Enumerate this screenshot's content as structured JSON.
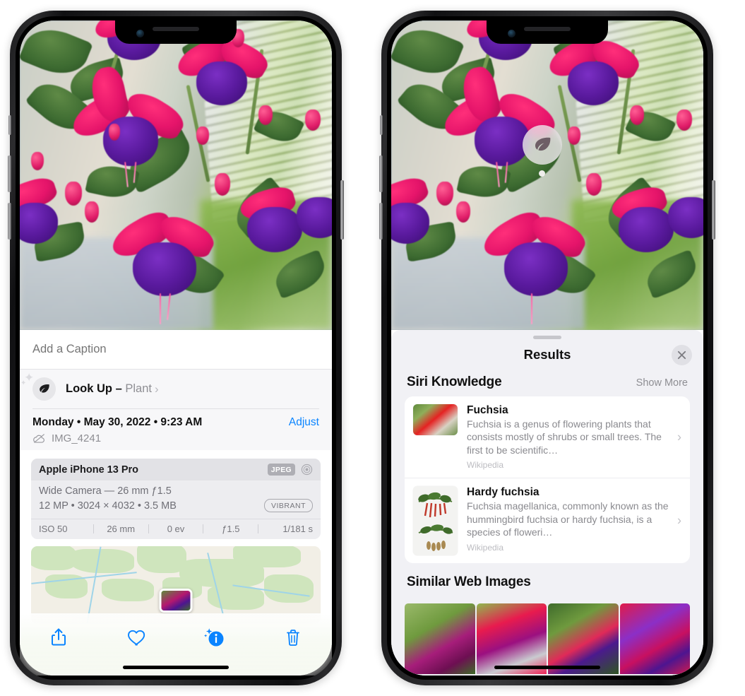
{
  "left_phone": {
    "name": "iphone-photos-info-view",
    "caption": {
      "placeholder": "Add a Caption",
      "value": ""
    },
    "lookup": {
      "label": "Look Up",
      "dash": "–",
      "subject": "Plant",
      "chevron": "›",
      "icon": "leaf-icon"
    },
    "meta": {
      "date_line": "Monday • May 30, 2022 • 9:23 AM",
      "adjust_label": "Adjust",
      "filename": "IMG_4241",
      "cloud_icon": "cloud-slash-icon"
    },
    "camera": {
      "device": "Apple iPhone 13 Pro",
      "format_badge": "JPEG",
      "aperture_icon": "aperture-icon",
      "lens_line": "Wide Camera — 26 mm ƒ1.5",
      "specs_line": "12 MP • 3024 × 4032 • 3.5 MB",
      "style_badge": "VIBRANT",
      "exif": [
        "ISO 50",
        "26 mm",
        "0 ev",
        "ƒ1.5",
        "1/181 s"
      ]
    },
    "toolbar": [
      {
        "name": "share-button",
        "icon": "share-icon"
      },
      {
        "name": "favorite-button",
        "icon": "heart-icon"
      },
      {
        "name": "info-button",
        "icon": "info-sparkle-icon"
      },
      {
        "name": "delete-button",
        "icon": "trash-icon"
      }
    ],
    "accent_blue": "#0a84ff"
  },
  "right_phone": {
    "name": "iphone-visual-lookup-results",
    "badge": {
      "icon": "leaf-icon",
      "label": ""
    },
    "sheet": {
      "title": "Results",
      "close_icon": "close-icon",
      "siri_knowledge": {
        "heading": "Siri Knowledge",
        "show_more": "Show More",
        "items": [
          {
            "title": "Fuchsia",
            "description": "Fuchsia is a genus of flowering plants that consists mostly of shrubs or small trees. The first to be scientific…",
            "source": "Wikipedia",
            "chevron": "›"
          },
          {
            "title": "Hardy fuchsia",
            "description": "Fuchsia magellanica, commonly known as the hummingbird fuchsia or hardy fuchsia, is a species of floweri…",
            "source": "Wikipedia",
            "chevron": "›"
          }
        ]
      },
      "similar_web_images": {
        "heading": "Similar Web Images",
        "count": 4
      }
    }
  }
}
